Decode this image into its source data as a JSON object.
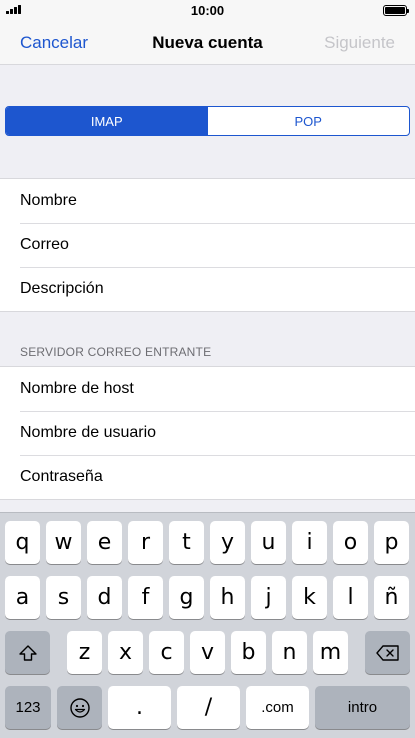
{
  "status_bar": {
    "time": "10:00"
  },
  "nav": {
    "cancel_label": "Cancelar",
    "title": "Nueva cuenta",
    "next_label": "Siguiente"
  },
  "account_type": {
    "options": [
      "IMAP",
      "POP"
    ],
    "selected": "IMAP"
  },
  "account_fields": [
    "Nombre",
    "Correo",
    "Descripción"
  ],
  "incoming_server": {
    "header": "SERVIDOR CORREO ENTRANTE",
    "fields": [
      "Nombre de host",
      "Nombre de usuario",
      "Contraseña"
    ]
  },
  "keyboard": {
    "row1": [
      "q",
      "w",
      "e",
      "r",
      "t",
      "y",
      "u",
      "i",
      "o",
      "p"
    ],
    "row2": [
      "a",
      "s",
      "d",
      "f",
      "g",
      "h",
      "j",
      "k",
      "l",
      "ñ"
    ],
    "row3": [
      "z",
      "x",
      "c",
      "v",
      "b",
      "n",
      "m"
    ],
    "numbers_label": "123",
    "period_label": ".",
    "slash_label": "/",
    "dotcom_label": ".com",
    "return_label": "intro"
  },
  "colors": {
    "accent": "#1d56cf",
    "disabled": "#c5c5c9",
    "background": "#efeff4",
    "keyboard_bg": "#d1d4da",
    "function_key": "#adb3bc"
  }
}
